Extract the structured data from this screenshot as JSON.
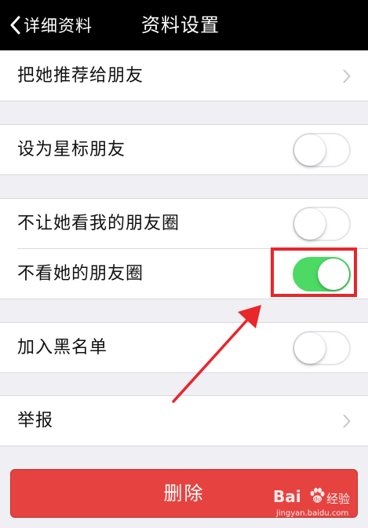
{
  "navbar": {
    "back_label": "详细资料",
    "title": "资料设置"
  },
  "rows": {
    "recommend": {
      "label": "把她推荐给朋友"
    },
    "star_friend": {
      "label": "设为星标朋友",
      "on": false
    },
    "hide_my_moments": {
      "label": "不让她看我的朋友圈",
      "on": false
    },
    "hide_her_moments": {
      "label": "不看她的朋友圈",
      "on": true
    },
    "blacklist": {
      "label": "加入黑名单",
      "on": false
    },
    "report": {
      "label": "举报"
    }
  },
  "delete_button": {
    "label": "删除"
  },
  "annotation": {
    "color": "#e8262b"
  },
  "watermark": {
    "brand": "Bai",
    "product": "经验",
    "url": "jingyan.baidu.com"
  },
  "colors": {
    "toggle_on": "#4cd964",
    "delete": "#e64340",
    "navbar": "#000000",
    "background": "#efeff4"
  }
}
